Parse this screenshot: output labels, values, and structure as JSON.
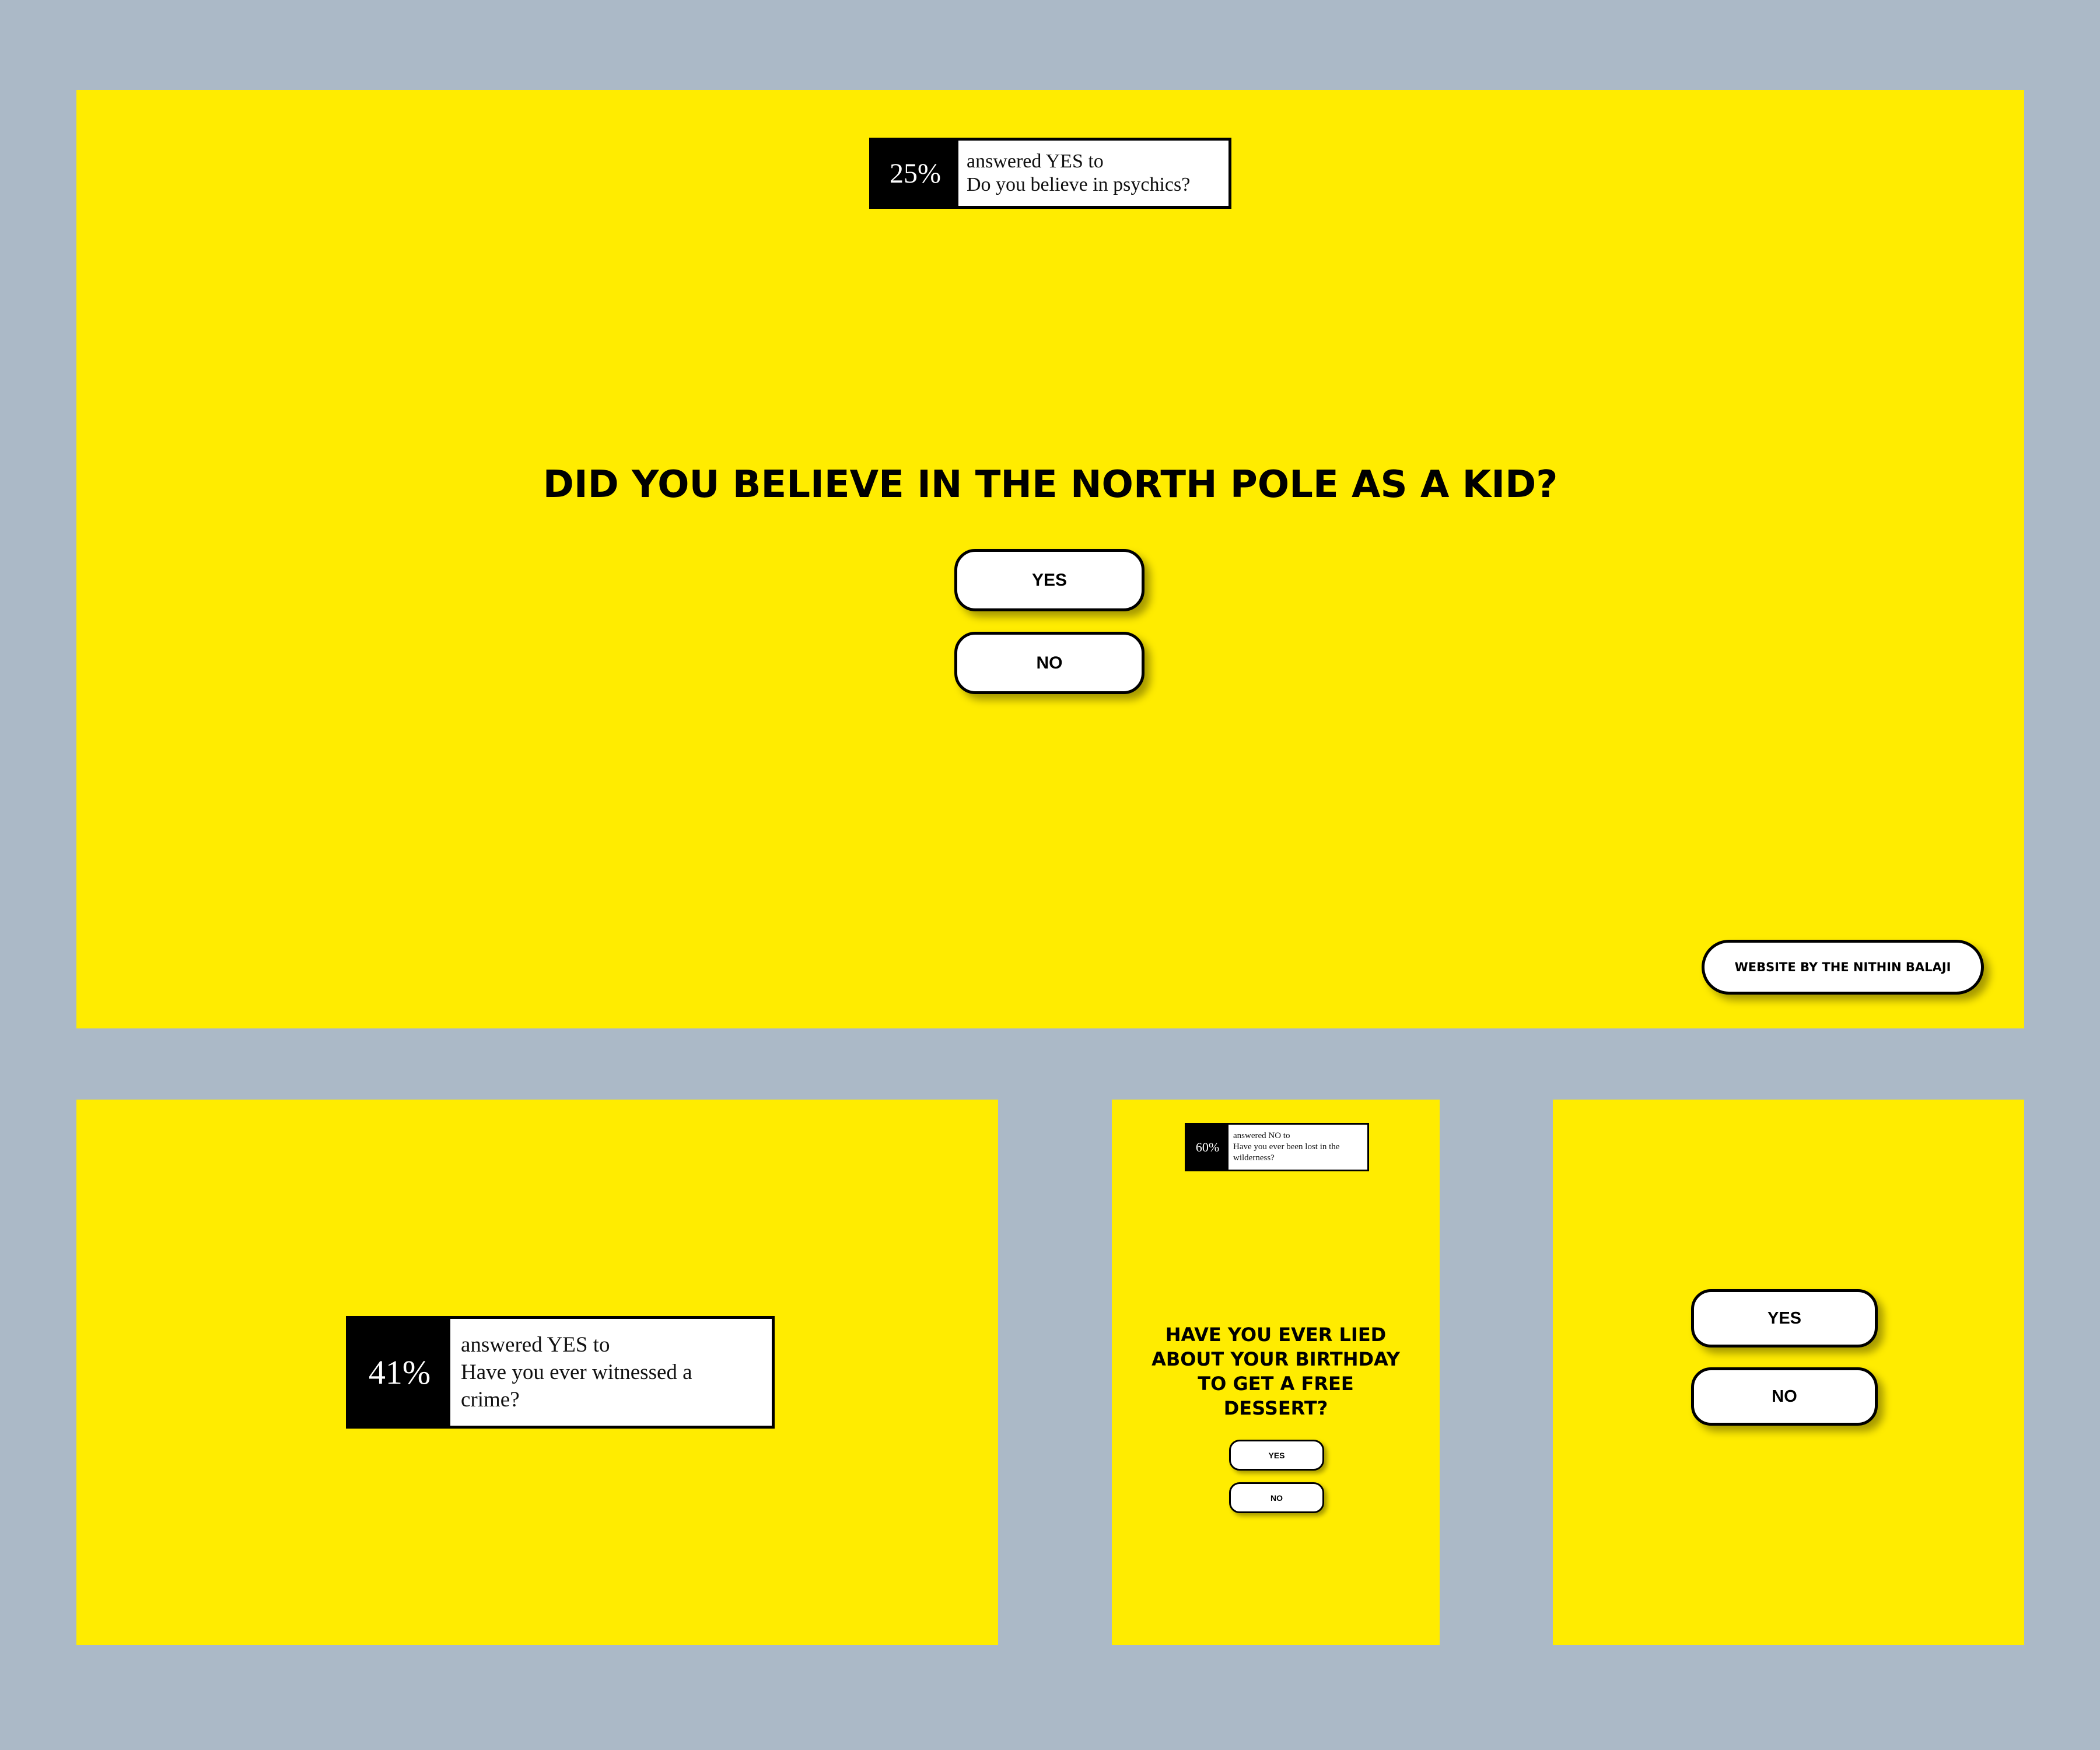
{
  "colors": {
    "page_background": "#abb9c7",
    "panel_background": "#ffec00",
    "badge_percent_bg": "#000000",
    "badge_text_bg": "#ffffff",
    "button_bg": "#ffffff",
    "text": "#000000"
  },
  "main": {
    "stat": {
      "percent": "25%",
      "line1": "answered YES to",
      "line2": "Do you believe in psychics?"
    },
    "question": "DID YOU BELIEVE IN THE NORTH POLE AS A KID?",
    "yes_label": "YES",
    "no_label": "NO",
    "credit_label": "WEBSITE BY THE NITHIN BALAJI"
  },
  "panel_2": {
    "stat": {
      "percent": "41%",
      "line1": "answered YES to",
      "line2": "Have you ever witnessed a crime?"
    }
  },
  "panel_3": {
    "stat": {
      "percent": "60%",
      "line1": "answered NO to",
      "line2": "Have you ever been lost in the wilderness?"
    },
    "question": "HAVE YOU EVER LIED ABOUT YOUR BIRTHDAY TO GET A FREE DESSERT?",
    "yes_label": "YES",
    "no_label": "NO"
  },
  "panel_4": {
    "yes_label": "YES",
    "no_label": "NO"
  }
}
